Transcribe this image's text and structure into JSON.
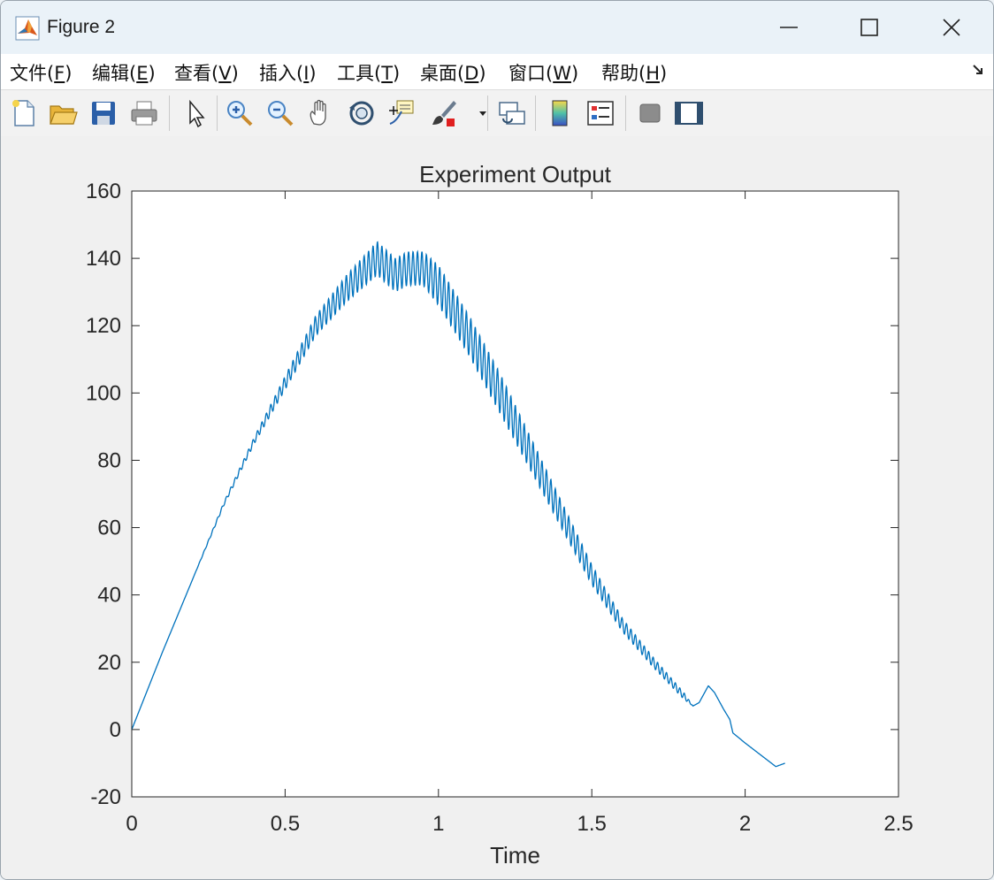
{
  "window": {
    "title": "Figure 2"
  },
  "menu": [
    {
      "label": "文件(",
      "mnemonic": "F",
      "suffix": ")"
    },
    {
      "label": "编辑(",
      "mnemonic": "E",
      "suffix": ")"
    },
    {
      "label": "查看(",
      "mnemonic": "V",
      "suffix": ")"
    },
    {
      "label": "插入(",
      "mnemonic": "I",
      "suffix": ")"
    },
    {
      "label": "工具(",
      "mnemonic": "T",
      "suffix": ")"
    },
    {
      "label": "桌面(",
      "mnemonic": "D",
      "suffix": ")"
    },
    {
      "label": "窗口(",
      "mnemonic": "W",
      "suffix": ")"
    },
    {
      "label": "帮助(",
      "mnemonic": "H",
      "suffix": ")"
    }
  ],
  "toolbar": {
    "icons": [
      "new-figure-icon",
      "open-file-icon",
      "save-icon",
      "print-icon",
      "edit-plot-icon",
      "zoom-in-icon",
      "zoom-out-icon",
      "pan-icon",
      "rotate-3d-icon",
      "data-cursor-icon",
      "brush-icon",
      "link-plot-icon",
      "colorbar-icon",
      "legend-icon",
      "hide-plot-tools-icon",
      "show-plot-tools-icon"
    ]
  },
  "chart_data": {
    "type": "line",
    "title": "Experiment Output",
    "xlabel": "Time",
    "ylabel": "",
    "xlim": [
      0,
      2.5
    ],
    "ylim": [
      -20,
      160
    ],
    "xticks": [
      "0",
      "0.5",
      "1",
      "1.5",
      "2",
      "2.5"
    ],
    "yticks": [
      "-20",
      "0",
      "20",
      "40",
      "60",
      "80",
      "100",
      "120",
      "140",
      "160"
    ],
    "grid": false,
    "line_color": "#0072bd",
    "series": [
      {
        "x": [
          0,
          0.1,
          0.2,
          0.3,
          0.4,
          0.5,
          0.6,
          0.7,
          0.8,
          0.86,
          0.9,
          0.95,
          1.0,
          1.1,
          1.2,
          1.3,
          1.4,
          1.5,
          1.6,
          1.7,
          1.8,
          1.83,
          1.85,
          1.88,
          1.9,
          1.93,
          1.95,
          1.96,
          2.0,
          2.05,
          2.1,
          2.13
        ],
        "y": [
          0,
          23,
          45,
          67,
          86,
          103,
          120,
          131,
          140,
          135,
          137,
          137,
          132,
          117,
          100,
          82,
          64,
          46,
          31,
          20,
          10,
          7,
          8,
          13,
          11,
          6,
          3,
          -1,
          -4,
          -7.5,
          -11,
          -10
        ],
        "oscillation_amplitude": [
          0,
          0,
          0,
          0.5,
          1,
          2,
          3,
          4,
          5,
          5,
          5,
          5,
          6,
          6,
          6,
          5,
          4,
          3,
          2,
          1.5,
          1,
          0,
          0,
          0,
          0,
          0,
          0,
          0,
          0,
          0,
          0,
          0
        ]
      }
    ]
  }
}
